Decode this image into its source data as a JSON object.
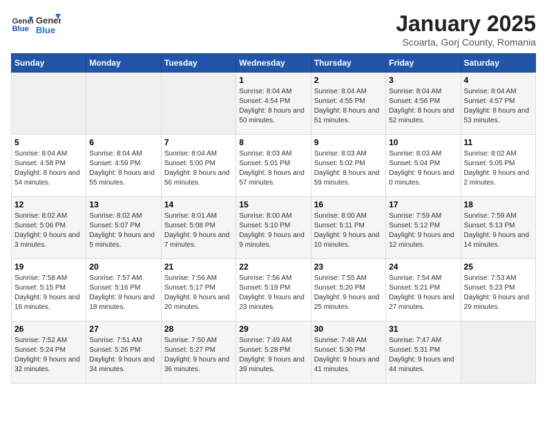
{
  "logo": {
    "general": "General",
    "blue": "Blue"
  },
  "calendar": {
    "title": "January 2025",
    "subtitle": "Scoarta, Gorj County, Romania"
  },
  "weekdays": [
    "Sunday",
    "Monday",
    "Tuesday",
    "Wednesday",
    "Thursday",
    "Friday",
    "Saturday"
  ],
  "weeks": [
    [
      {
        "day": "",
        "empty": true
      },
      {
        "day": "",
        "empty": true
      },
      {
        "day": "",
        "empty": true
      },
      {
        "day": "1",
        "sunrise": "8:04 AM",
        "sunset": "4:54 PM",
        "daylight": "8 hours and 50 minutes."
      },
      {
        "day": "2",
        "sunrise": "8:04 AM",
        "sunset": "4:55 PM",
        "daylight": "8 hours and 51 minutes."
      },
      {
        "day": "3",
        "sunrise": "8:04 AM",
        "sunset": "4:56 PM",
        "daylight": "8 hours and 52 minutes."
      },
      {
        "day": "4",
        "sunrise": "8:04 AM",
        "sunset": "4:57 PM",
        "daylight": "8 hours and 53 minutes."
      }
    ],
    [
      {
        "day": "5",
        "sunrise": "8:04 AM",
        "sunset": "4:58 PM",
        "daylight": "8 hours and 54 minutes."
      },
      {
        "day": "6",
        "sunrise": "8:04 AM",
        "sunset": "4:59 PM",
        "daylight": "8 hours and 55 minutes."
      },
      {
        "day": "7",
        "sunrise": "8:04 AM",
        "sunset": "5:00 PM",
        "daylight": "8 hours and 56 minutes."
      },
      {
        "day": "8",
        "sunrise": "8:03 AM",
        "sunset": "5:01 PM",
        "daylight": "8 hours and 57 minutes."
      },
      {
        "day": "9",
        "sunrise": "8:03 AM",
        "sunset": "5:02 PM",
        "daylight": "8 hours and 59 minutes."
      },
      {
        "day": "10",
        "sunrise": "8:03 AM",
        "sunset": "5:04 PM",
        "daylight": "9 hours and 0 minutes."
      },
      {
        "day": "11",
        "sunrise": "8:02 AM",
        "sunset": "5:05 PM",
        "daylight": "9 hours and 2 minutes."
      }
    ],
    [
      {
        "day": "12",
        "sunrise": "8:02 AM",
        "sunset": "5:06 PM",
        "daylight": "9 hours and 3 minutes."
      },
      {
        "day": "13",
        "sunrise": "8:02 AM",
        "sunset": "5:07 PM",
        "daylight": "9 hours and 5 minutes."
      },
      {
        "day": "14",
        "sunrise": "8:01 AM",
        "sunset": "5:08 PM",
        "daylight": "9 hours and 7 minutes."
      },
      {
        "day": "15",
        "sunrise": "8:00 AM",
        "sunset": "5:10 PM",
        "daylight": "9 hours and 9 minutes."
      },
      {
        "day": "16",
        "sunrise": "8:00 AM",
        "sunset": "5:11 PM",
        "daylight": "9 hours and 10 minutes."
      },
      {
        "day": "17",
        "sunrise": "7:59 AM",
        "sunset": "5:12 PM",
        "daylight": "9 hours and 12 minutes."
      },
      {
        "day": "18",
        "sunrise": "7:59 AM",
        "sunset": "5:13 PM",
        "daylight": "9 hours and 14 minutes."
      }
    ],
    [
      {
        "day": "19",
        "sunrise": "7:58 AM",
        "sunset": "5:15 PM",
        "daylight": "9 hours and 16 minutes."
      },
      {
        "day": "20",
        "sunrise": "7:57 AM",
        "sunset": "5:16 PM",
        "daylight": "9 hours and 18 minutes."
      },
      {
        "day": "21",
        "sunrise": "7:56 AM",
        "sunset": "5:17 PM",
        "daylight": "9 hours and 20 minutes."
      },
      {
        "day": "22",
        "sunrise": "7:56 AM",
        "sunset": "5:19 PM",
        "daylight": "9 hours and 23 minutes."
      },
      {
        "day": "23",
        "sunrise": "7:55 AM",
        "sunset": "5:20 PM",
        "daylight": "9 hours and 25 minutes."
      },
      {
        "day": "24",
        "sunrise": "7:54 AM",
        "sunset": "5:21 PM",
        "daylight": "9 hours and 27 minutes."
      },
      {
        "day": "25",
        "sunrise": "7:53 AM",
        "sunset": "5:23 PM",
        "daylight": "9 hours and 29 minutes."
      }
    ],
    [
      {
        "day": "26",
        "sunrise": "7:52 AM",
        "sunset": "5:24 PM",
        "daylight": "9 hours and 32 minutes."
      },
      {
        "day": "27",
        "sunrise": "7:51 AM",
        "sunset": "5:26 PM",
        "daylight": "9 hours and 34 minutes."
      },
      {
        "day": "28",
        "sunrise": "7:50 AM",
        "sunset": "5:27 PM",
        "daylight": "9 hours and 36 minutes."
      },
      {
        "day": "29",
        "sunrise": "7:49 AM",
        "sunset": "5:28 PM",
        "daylight": "9 hours and 39 minutes."
      },
      {
        "day": "30",
        "sunrise": "7:48 AM",
        "sunset": "5:30 PM",
        "daylight": "9 hours and 41 minutes."
      },
      {
        "day": "31",
        "sunrise": "7:47 AM",
        "sunset": "5:31 PM",
        "daylight": "9 hours and 44 minutes."
      },
      {
        "day": "",
        "empty": true
      }
    ]
  ]
}
